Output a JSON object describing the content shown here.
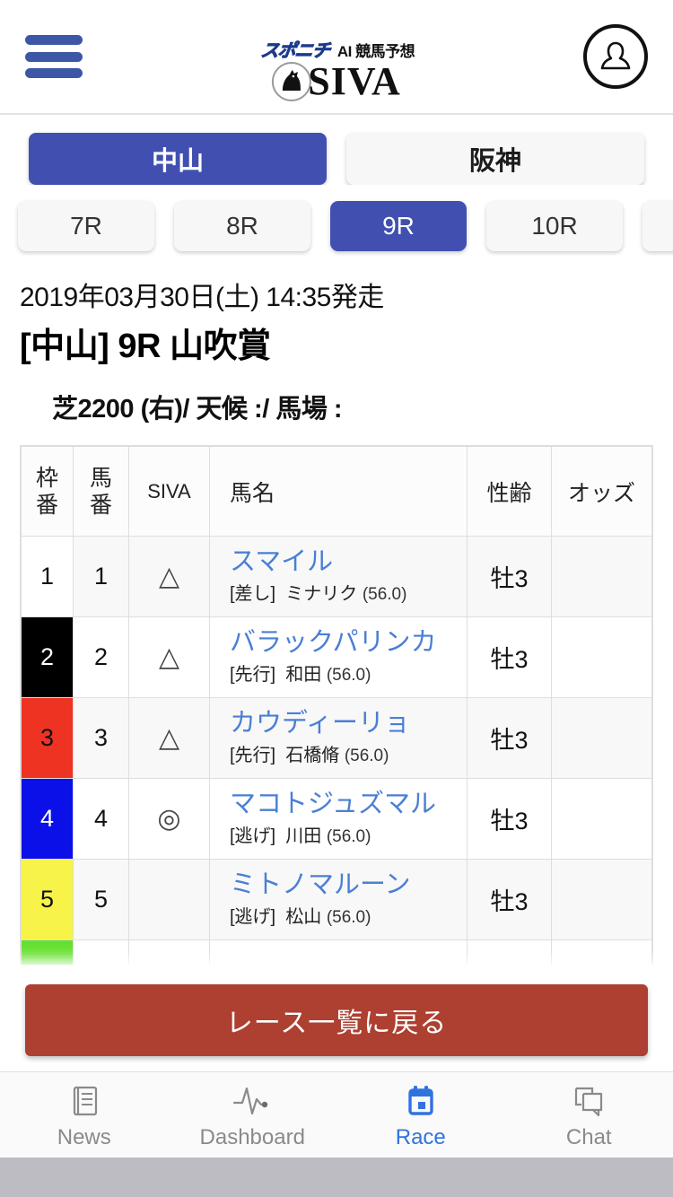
{
  "header": {
    "menu_icon": "hamburger-icon",
    "brand_sponichi": "スポニチ",
    "brand_ai": "AI 競馬予想",
    "brand_siva": "SIVA",
    "brand_horse_icon": "horse-head-icon",
    "avatar_icon": "user-avatar-icon"
  },
  "venues": [
    {
      "label": "中山",
      "active": true
    },
    {
      "label": "阪神",
      "active": false
    }
  ],
  "races": [
    {
      "label": "7R",
      "active": false
    },
    {
      "label": "8R",
      "active": false
    },
    {
      "label": "9R",
      "active": true
    },
    {
      "label": "10R",
      "active": false
    },
    {
      "label": "",
      "active": false
    }
  ],
  "race_info": {
    "date": "2019年03月30日(土) 14:35発走",
    "title": "[中山] 9R 山吹賞",
    "condition": "芝2200 (右)/ 天候 :/ 馬場 :"
  },
  "table": {
    "headers": {
      "waku": "枠番",
      "waku_l1": "枠",
      "waku_l2": "番",
      "uma": "馬番",
      "uma_l1": "馬",
      "uma_l2": "番",
      "siva": "SIVA",
      "name": "馬名",
      "sex": "性齢",
      "odds": "オッズ"
    },
    "rows": [
      {
        "waku": "1",
        "waku_color": "w1",
        "uma": "1",
        "siva": "△",
        "horse": "スマイル",
        "style": "[差し]",
        "jockey": "ミナリク",
        "weight": "(56.0)",
        "sex": "牡3",
        "odds": ""
      },
      {
        "waku": "2",
        "waku_color": "w2",
        "uma": "2",
        "siva": "△",
        "horse": "バラックパリンカ",
        "style": "[先行]",
        "jockey": "和田",
        "weight": "(56.0)",
        "sex": "牡3",
        "odds": ""
      },
      {
        "waku": "3",
        "waku_color": "w3",
        "uma": "3",
        "siva": "△",
        "horse": "カウディーリョ",
        "style": "[先行]",
        "jockey": "石橋脩",
        "weight": "(56.0)",
        "sex": "牡3",
        "odds": ""
      },
      {
        "waku": "4",
        "waku_color": "w4",
        "uma": "4",
        "siva": "◎",
        "horse": "マコトジュズマル",
        "style": "[逃げ]",
        "jockey": "川田",
        "weight": "(56.0)",
        "sex": "牡3",
        "odds": ""
      },
      {
        "waku": "5",
        "waku_color": "w5",
        "uma": "5",
        "siva": "",
        "horse": "ミトノマルーン",
        "style": "[逃げ]",
        "jockey": "松山",
        "weight": "(56.0)",
        "sex": "牡3",
        "odds": ""
      },
      {
        "waku": "",
        "waku_color": "w6",
        "uma": "",
        "siva": "",
        "horse": "",
        "style": "",
        "jockey": "",
        "weight": "",
        "sex": "",
        "odds": ""
      }
    ]
  },
  "back_button": {
    "label": "レース一覧に戻る",
    "color": "#ad4030"
  },
  "bottom_nav": {
    "items": [
      {
        "label": "News",
        "icon": "news-document-icon",
        "active": false
      },
      {
        "label": "Dashboard",
        "icon": "activity-pulse-icon",
        "active": false
      },
      {
        "label": "Race",
        "icon": "calendar-icon",
        "active": true
      },
      {
        "label": "Chat",
        "icon": "chat-bubbles-icon",
        "active": false
      }
    ],
    "active_color": "#2f73e0"
  }
}
